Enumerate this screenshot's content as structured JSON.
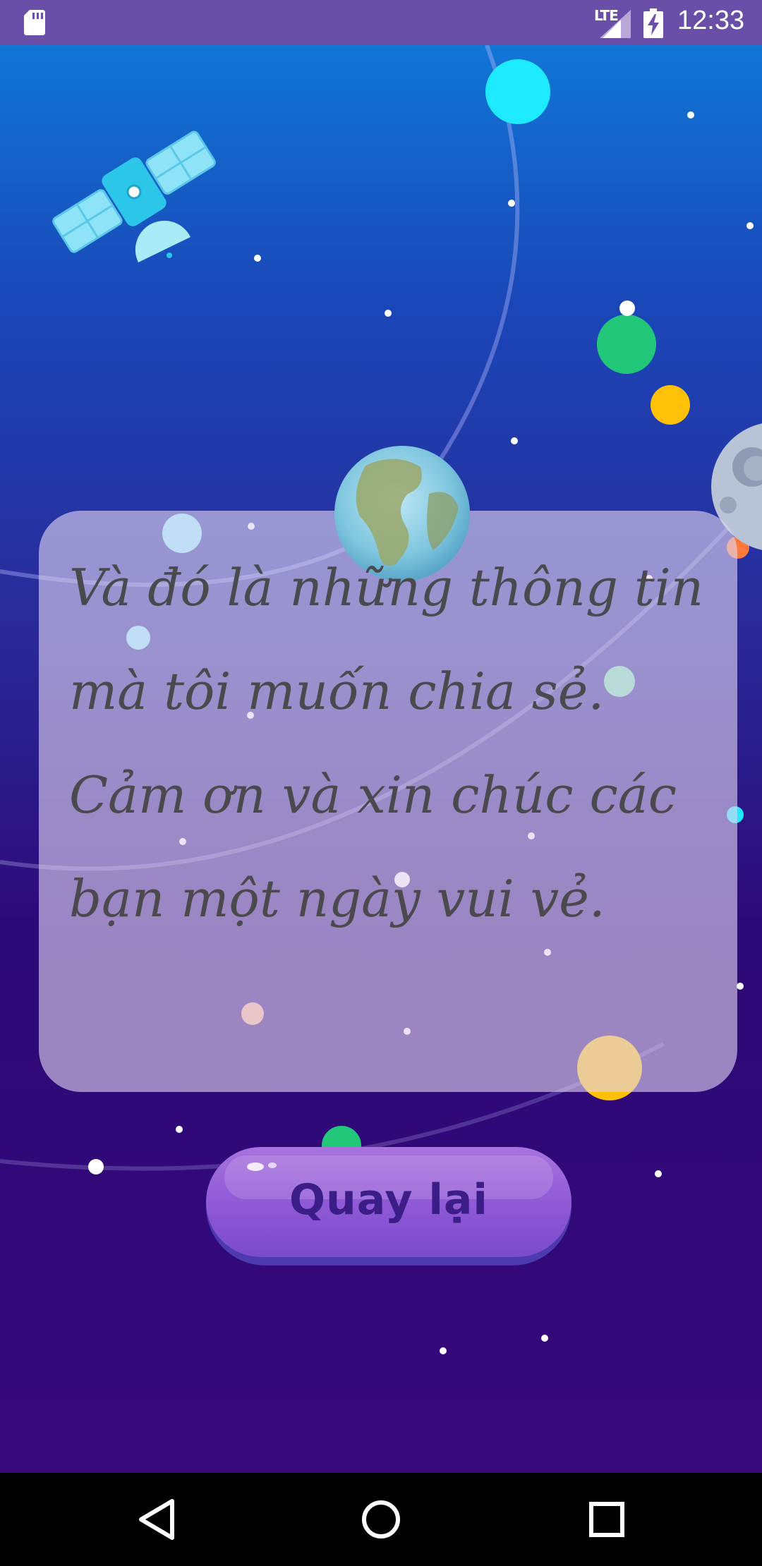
{
  "status_bar": {
    "network": "LTE",
    "time": "12:33",
    "icons": [
      "sd-card-icon",
      "signal-icon",
      "battery-charging-icon"
    ]
  },
  "message": {
    "text": "Và đó là những thông tin mà tôi muốn chia sẻ. Cảm ơn và xin chúc các bạn một ngày vui vẻ."
  },
  "back_button": {
    "label": "Quay lại"
  },
  "nav_bar": {
    "icons": [
      "back-triangle-icon",
      "home-circle-icon",
      "recents-square-icon"
    ]
  },
  "colors": {
    "status_bar": "#6a4fa8",
    "space_top": "#1176d6",
    "space_bottom": "#37087a",
    "text": "#4a4a4e",
    "button": "#8e58d6",
    "button_label": "#3a1d86"
  }
}
